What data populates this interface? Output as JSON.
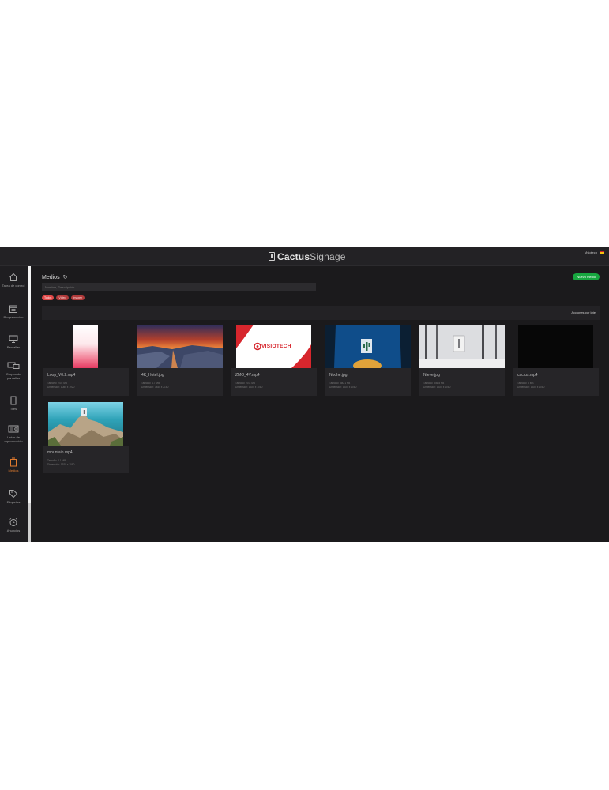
{
  "header": {
    "brand_bold": "Cactus",
    "brand_light": "Signage",
    "user": "Visiotech"
  },
  "sidebar": {
    "items": [
      {
        "label": "Tarea de control",
        "icon": "home-icon"
      },
      {
        "label": "Programación",
        "icon": "calendar-icon"
      },
      {
        "label": "Pantallas",
        "icon": "monitor-icon"
      },
      {
        "label": "Grupos de pantallas",
        "icon": "screens-group-icon"
      },
      {
        "label": "Tiles",
        "icon": "tile-icon"
      },
      {
        "label": "Listas de reproducción",
        "icon": "playlist-icon"
      },
      {
        "label": "Medios",
        "icon": "media-icon",
        "active": true
      },
      {
        "label": "Etiquetas",
        "icon": "tag-icon"
      },
      {
        "label": "Anuncios",
        "icon": "alarm-icon"
      }
    ]
  },
  "main": {
    "title": "Medios",
    "new_button": "Nuevo medio",
    "search_placeholder": "Nombre, Descripción",
    "filters": [
      "Todos",
      "Vídeo",
      "Imagen"
    ],
    "bar_action": "Acciones por lote",
    "media": [
      {
        "name": "Loop_V0.2.mp4",
        "meta1": "Tamaño: 24.6 MB",
        "meta2": "Dimensión: 1080 x 1920",
        "thumb": "pink-gradient"
      },
      {
        "name": "4K_Hotel.jpg",
        "meta1": "Tamaño: 4.7 MB",
        "meta2": "Dimensión: 3840 x 2160",
        "thumb": "sunset-rocks"
      },
      {
        "name": "ZMO_4V.mp4",
        "meta1": "Tamaño: 20.8 MB",
        "meta2": "Dimensión: 1920 x 1080",
        "thumb": "visiotech-logo",
        "logo_text": "VISIOTECH"
      },
      {
        "name": "Noche.jpg",
        "meta1": "Tamaño: 380.1 KB",
        "meta2": "Dimensión: 1920 x 1080",
        "thumb": "night-cactus"
      },
      {
        "name": "Nieve.jpg",
        "meta1": "Tamaño: 846.8 KB",
        "meta2": "Dimensión: 1920 x 1080",
        "thumb": "snow-forest"
      },
      {
        "name": "cactus.mp4",
        "meta1": "Tamaño: 5 MB",
        "meta2": "Dimensión: 1920 x 1080",
        "thumb": "black"
      },
      {
        "name": "mountain.mp4",
        "meta1": "Tamaño: 2.1 MB",
        "meta2": "Dimensión: 1920 x 1080",
        "thumb": "mountain-sea"
      }
    ]
  },
  "colors": {
    "background": "#1b1a1c",
    "accent_green": "#17a63f",
    "chip_red": "#e14848",
    "active_nav": "#e07b2e"
  }
}
